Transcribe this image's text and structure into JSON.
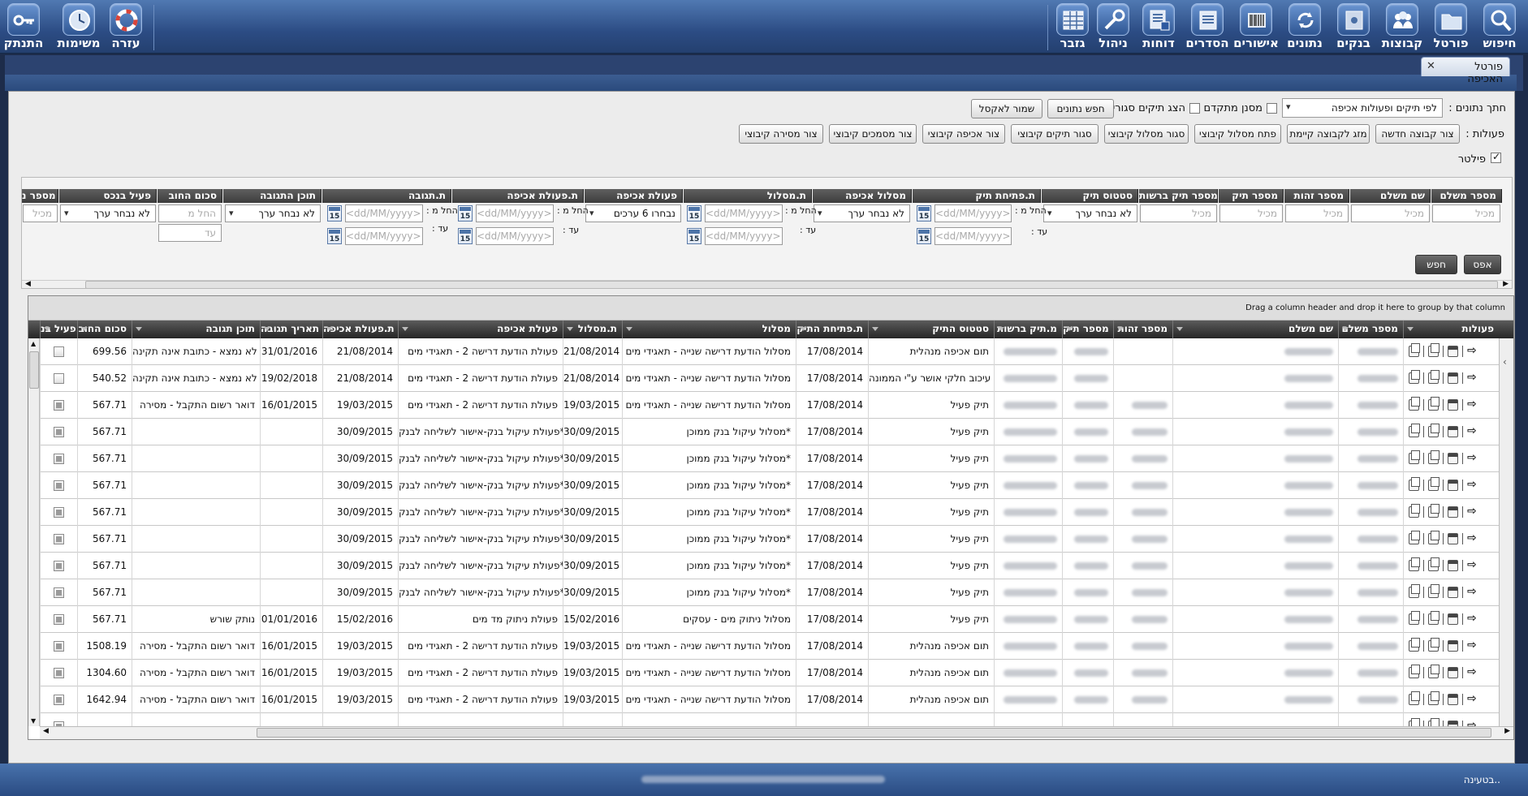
{
  "toolbar": {
    "right_items": [
      "חיפוש",
      "פורטל",
      "קבוצות",
      "בנקים",
      "נתונים",
      "אישורים",
      "הסדרים",
      "דוחות",
      "ניהול",
      "גזבר"
    ],
    "left_items": [
      "עזרה",
      "משימות",
      "התנתק"
    ]
  },
  "tab": {
    "title": "פורטל האכיפה",
    "close": "✕"
  },
  "controls": {
    "data_filter_label": "חתך נתונים :",
    "data_filter_value": "לפי תיקים ופעולות אכיפה",
    "advanced_filter_label": "מסנן מתקדם",
    "show_closed_label": "הצג תיקים סגורים",
    "search_data_button": "חפש נתונים",
    "export_excel_button": "שמור לאקסל",
    "actions_label": "פעולות :",
    "action_buttons": [
      "צור קבוצה חדשה",
      "מזג לקבוצה קיימת",
      "פתח מסלול קיבוצי",
      "סגור מסלול קיבוצי",
      "סגור תיקים קיבוצי",
      "צור אכיפה קיבוצי",
      "צור מסמכים קיבוצי",
      "צור מסירה קיבוצי"
    ],
    "filter_label": "פילטר"
  },
  "filters": {
    "headers": [
      "מספר משלם",
      "שם משלם",
      "מספר זהות",
      "מספר תיק",
      "מספר תיק ברשות",
      "סטטוס תיק",
      "ת.פתיחת תיק",
      "מסלול אכיפה",
      "ת.מסלול",
      "פעולת אכיפה",
      "ת.פעולת אכיפה",
      "ת.תגובה",
      "תוכן התגובה",
      "סכום החוב",
      "פעיל בנכס",
      "מספר נ"
    ],
    "contains_placeholder": "מכיל",
    "not_selected": "לא נבחר ערך",
    "six_selected": "נבחרו 6 ערכים",
    "date_placeholder": "<dd/MM/yyyy>",
    "from_label": "החל מ :",
    "to_label": "עד :",
    "from_short": "החל מ",
    "to_short": "עד",
    "cal_day": "15",
    "reset_button": "אפס",
    "search_button": "חפש"
  },
  "grid": {
    "group_hint": "Drag a column header and drop it here to group by that column",
    "headers": [
      "פעולות",
      "מספר משלם",
      "שם משלם",
      "מספר זהות",
      "מספר תיק",
      "מ.תיק ברשות",
      "סטטוס התיק",
      "ת.פתיחת התיק",
      "מסלול",
      "ת.מסלול",
      "פעולת אכיפה",
      "ת.פעולת אכיפה",
      "תאריך תגובה",
      "תוכן תגובה",
      "סכום החוב",
      "פעיל בנ"
    ],
    "rows": [
      {
        "status": "תום אכיפה מנהלית",
        "open": "17/08/2014",
        "track": "מסלול הודעת דרישה שנייה - תאגידי מים",
        "track_date": "21/08/2014",
        "action": "פעולת הודעת דרישה 2 - תאגידי מים",
        "action_date": "21/08/2014",
        "resp_date": "31/01/2016",
        "resp": "לא נמצא - כתובת אינה תקינה",
        "amount": "699.56",
        "active": false
      },
      {
        "status": "עיכוב חלקי אושר ע\"י הממונה",
        "open": "17/08/2014",
        "track": "מסלול הודעת דרישה שנייה - תאגידי מים",
        "track_date": "21/08/2014",
        "action": "פעולת הודעת דרישה 2 - תאגידי מים",
        "action_date": "21/08/2014",
        "resp_date": "19/02/2018",
        "resp": "לא נמצא - כתובת אינה תקינה",
        "amount": "540.52",
        "active": false
      },
      {
        "status": "תיק פעיל",
        "open": "17/08/2014",
        "track": "מסלול הודעת דרישה שנייה - תאגידי מים",
        "track_date": "19/03/2015",
        "action": "פעולת הודעת דרישה 2 - תאגידי מים",
        "action_date": "19/03/2015",
        "resp_date": "16/01/2015",
        "resp": "דואר רשום התקבל - מסירה",
        "amount": "567.71",
        "active": true
      },
      {
        "status": "תיק פעיל",
        "open": "17/08/2014",
        "track": "מסלול עיקול בנק ממוכן*",
        "track_date": "30/09/2015",
        "action": "פעולת עיקול בנק-אישור לשליחה לבנק*",
        "action_date": "30/09/2015",
        "resp_date": "",
        "resp": "",
        "amount": "567.71",
        "active": true
      },
      {
        "status": "תיק פעיל",
        "open": "17/08/2014",
        "track": "מסלול עיקול בנק ממוכן*",
        "track_date": "30/09/2015",
        "action": "פעולת עיקול בנק-אישור לשליחה לבנק*",
        "action_date": "30/09/2015",
        "resp_date": "",
        "resp": "",
        "amount": "567.71",
        "active": true
      },
      {
        "status": "תיק פעיל",
        "open": "17/08/2014",
        "track": "מסלול עיקול בנק ממוכן*",
        "track_date": "30/09/2015",
        "action": "פעולת עיקול בנק-אישור לשליחה לבנק*",
        "action_date": "30/09/2015",
        "resp_date": "",
        "resp": "",
        "amount": "567.71",
        "active": true
      },
      {
        "status": "תיק פעיל",
        "open": "17/08/2014",
        "track": "מסלול עיקול בנק ממוכן*",
        "track_date": "30/09/2015",
        "action": "פעולת עיקול בנק-אישור לשליחה לבנק*",
        "action_date": "30/09/2015",
        "resp_date": "",
        "resp": "",
        "amount": "567.71",
        "active": true
      },
      {
        "status": "תיק פעיל",
        "open": "17/08/2014",
        "track": "מסלול עיקול בנק ממוכן*",
        "track_date": "30/09/2015",
        "action": "פעולת עיקול בנק-אישור לשליחה לבנק*",
        "action_date": "30/09/2015",
        "resp_date": "",
        "resp": "",
        "amount": "567.71",
        "active": true
      },
      {
        "status": "תיק פעיל",
        "open": "17/08/2014",
        "track": "מסלול עיקול בנק ממוכן*",
        "track_date": "30/09/2015",
        "action": "פעולת עיקול בנק-אישור לשליחה לבנק*",
        "action_date": "30/09/2015",
        "resp_date": "",
        "resp": "",
        "amount": "567.71",
        "active": true
      },
      {
        "status": "תיק פעיל",
        "open": "17/08/2014",
        "track": "מסלול עיקול בנק ממוכן*",
        "track_date": "30/09/2015",
        "action": "פעולת עיקול בנק-אישור לשליחה לבנק*",
        "action_date": "30/09/2015",
        "resp_date": "",
        "resp": "",
        "amount": "567.71",
        "active": true
      },
      {
        "status": "תיק פעיל",
        "open": "17/08/2014",
        "track": "מסלול ניתוק מים - עסקים",
        "track_date": "15/02/2016",
        "action": "פעולת ניתוק מד מים",
        "action_date": "15/02/2016",
        "resp_date": "01/01/2016",
        "resp": "נותק שורש",
        "amount": "567.71",
        "active": true
      },
      {
        "status": "תום אכיפה מנהלית",
        "open": "17/08/2014",
        "track": "מסלול הודעת דרישה שנייה - תאגידי מים",
        "track_date": "19/03/2015",
        "action": "פעולת הודעת דרישה 2 - תאגידי מים",
        "action_date": "19/03/2015",
        "resp_date": "16/01/2015",
        "resp": "דואר רשום התקבל - מסירה",
        "amount": "1508.19",
        "active": true
      },
      {
        "status": "תום אכיפה מנהלית",
        "open": "17/08/2014",
        "track": "מסלול הודעת דרישה שנייה - תאגידי מים",
        "track_date": "19/03/2015",
        "action": "פעולת הודעת דרישה 2 - תאגידי מים",
        "action_date": "19/03/2015",
        "resp_date": "16/01/2015",
        "resp": "דואר רשום התקבל - מסירה",
        "amount": "1304.60",
        "active": true
      },
      {
        "status": "תום אכיפה מנהלית",
        "open": "17/08/2014",
        "track": "מסלול הודעת דרישה שנייה - תאגידי מים",
        "track_date": "19/03/2015",
        "action": "פעולת הודעת דרישה 2 - תאגידי מים",
        "action_date": "19/03/2015",
        "resp_date": "16/01/2015",
        "resp": "דואר רשום התקבל - מסירה",
        "amount": "1642.94",
        "active": true
      },
      {
        "status": "",
        "open": "",
        "track": "",
        "track_date": "",
        "action": "",
        "action_date": "",
        "resp_date": "",
        "resp": "",
        "amount": "",
        "active": true
      }
    ]
  },
  "status": {
    "loading": "בטעינה.."
  }
}
